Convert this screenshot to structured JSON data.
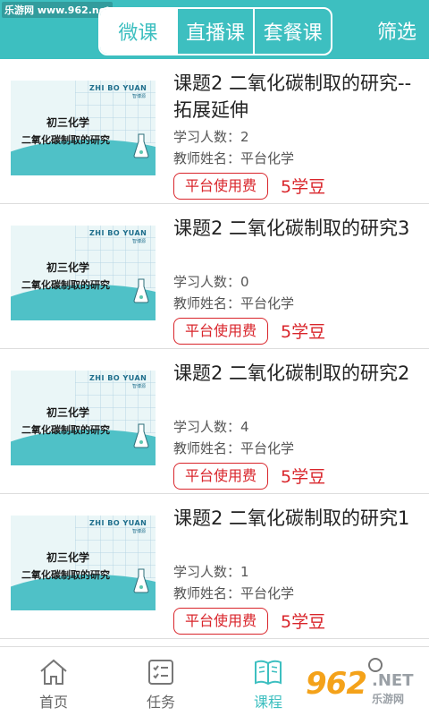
{
  "watermark_top": "乐游网 www.962.net",
  "header": {
    "tabs": [
      {
        "label": "微课",
        "active": true
      },
      {
        "label": "直播课",
        "active": false
      },
      {
        "label": "套餐课",
        "active": false
      }
    ],
    "filter_label": "筛选"
  },
  "thumbnail": {
    "brand": "ZHI BO YUAN",
    "brand_sub": "智博源",
    "line1": "初三化学",
    "line2": "二氧化碳制取的研究"
  },
  "courses": [
    {
      "title": "课题2 二氧化碳制取的研究--拓展延伸",
      "students_label": "学习人数：",
      "students": "2",
      "teacher_label": "教师姓名：",
      "teacher": "平台化学",
      "fee_label": "平台使用费",
      "price": "5学豆"
    },
    {
      "title": "课题2 二氧化碳制取的研究3",
      "students_label": "学习人数：",
      "students": "0",
      "teacher_label": "教师姓名：",
      "teacher": "平台化学",
      "fee_label": "平台使用费",
      "price": "5学豆"
    },
    {
      "title": "课题2 二氧化碳制取的研究2",
      "students_label": "学习人数：",
      "students": "4",
      "teacher_label": "教师姓名：",
      "teacher": "平台化学",
      "fee_label": "平台使用费",
      "price": "5学豆"
    },
    {
      "title": "课题2 二氧化碳制取的研究1",
      "students_label": "学习人数：",
      "students": "1",
      "teacher_label": "教师姓名：",
      "teacher": "平台化学",
      "fee_label": "平台使用费",
      "price": "5学豆"
    }
  ],
  "bottom_nav": [
    {
      "label": "首页",
      "icon": "home-icon",
      "active": false
    },
    {
      "label": "任务",
      "icon": "task-icon",
      "active": false
    },
    {
      "label": "课程",
      "icon": "book-icon",
      "active": true
    },
    {
      "label": "",
      "icon": "profile-icon",
      "active": false
    }
  ],
  "watermark_bottom": {
    "digits": "962",
    "net": ".NET",
    "cn": "乐游网"
  },
  "colors": {
    "accent": "#3dbfc0",
    "price": "#d9252b"
  }
}
